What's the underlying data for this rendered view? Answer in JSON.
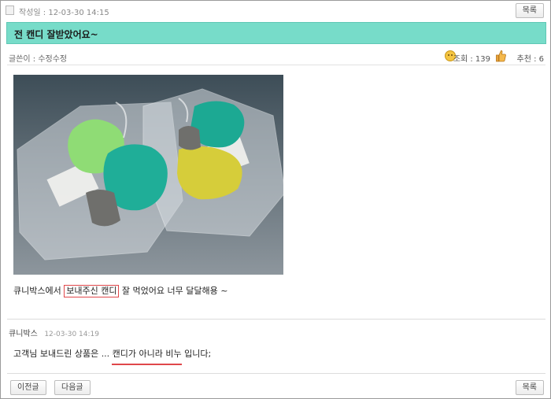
{
  "header": {
    "date_label": "작성일 : 12-03-30 14:15",
    "list_button": "목록"
  },
  "post": {
    "title": "전 캔디 잘받았어요~",
    "author_label": "글쓴이 : 수정수정",
    "views_label": "조회 : 139",
    "recommend_label": "추천 : 6",
    "body_before": "큐니박스에서 ",
    "body_highlight": "보내주신 캔디",
    "body_after": " 잘 먹었어요 너무 달달해용 ~"
  },
  "comment": {
    "author": "큐니박스",
    "date": "12-03-30 14:19",
    "text": "고객님 보내드린 상품은 ... 캔디가 아니라 비누 입니다;"
  },
  "footer": {
    "prev_button": "이전글",
    "next_button": "다음글",
    "list_button": "목록"
  }
}
